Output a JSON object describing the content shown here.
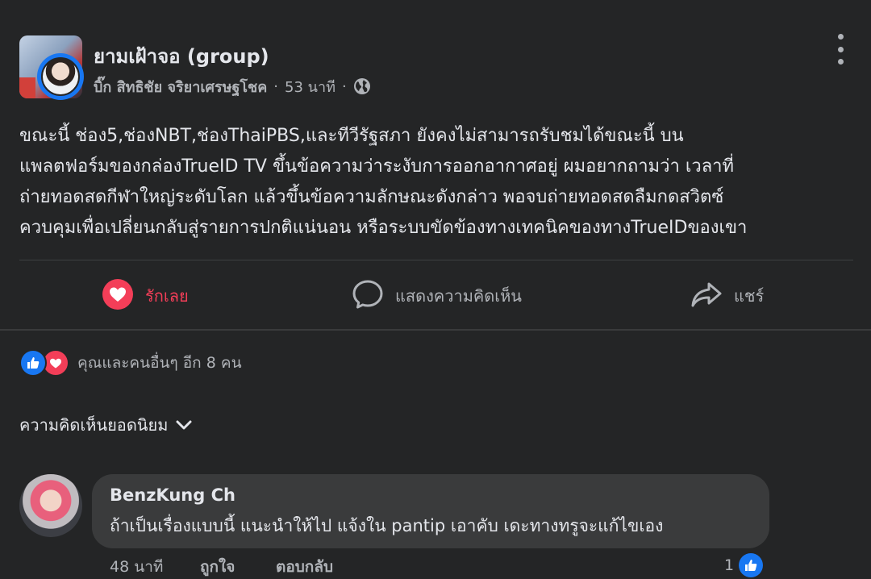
{
  "post": {
    "group_name": "ยามเฝ้าจอ (group)",
    "author": "บิ๊ก สิทธิชัย จริยาเศรษฐโชค",
    "separator": "·",
    "time": "53 นาที",
    "privacy_icon": "globe-icon",
    "text_lines": [
      "ขณะนี้ ช่อง5,ช่องNBT,ช่องThaiPBS,และทีวีรัฐสภา ยังคงไม่สามารถรับชมได้ขณะนี้ บน",
      "แพลตฟอร์มของกล่องTrueID TV ขึ้นข้อความว่าระงับการออกอากาศอยู่ ผมอยากถามว่า เวลาที่",
      "ถ่ายทอดสดกีฬาใหญ่ระดับโลก แล้วขึ้นข้อความลักษณะดังกล่าว พอจบถ่ายทอดสดลืมกดสวิตซ์",
      "ควบคุมเพื่อเปลี่ยนกลับสู่รายการปกติแน่นอน หรือระบบขัดข้องทางเทคนิคของทางTrueIDของเขา"
    ]
  },
  "actions": {
    "like_label": "รักเลย",
    "comment_label": "แสดงความคิดเห็น",
    "share_label": "แชร์"
  },
  "reactions": {
    "summary": "คุณและคนอื่นๆ อีก 8 คน"
  },
  "comments_section": {
    "sort_label": "ความคิดเห็นยอดนิยม"
  },
  "comment": {
    "author": "BenzKung Ch",
    "text": "ถ้าเป็นเรื่องแบบนี้ แนะนำให้ไป แจ้งใน pantip เอาคับ เดะทางทรูจะแก้ไขเอง",
    "time": "48 นาที",
    "like_label": "ถูกใจ",
    "reply_label": "ตอบกลับ",
    "like_count": "1"
  },
  "colors": {
    "background": "#242526",
    "bubble": "#3a3b3c",
    "love": "#f33e58",
    "like": "#1877f2",
    "text_primary": "#e4e6eb",
    "text_secondary": "#b0b3b8"
  }
}
